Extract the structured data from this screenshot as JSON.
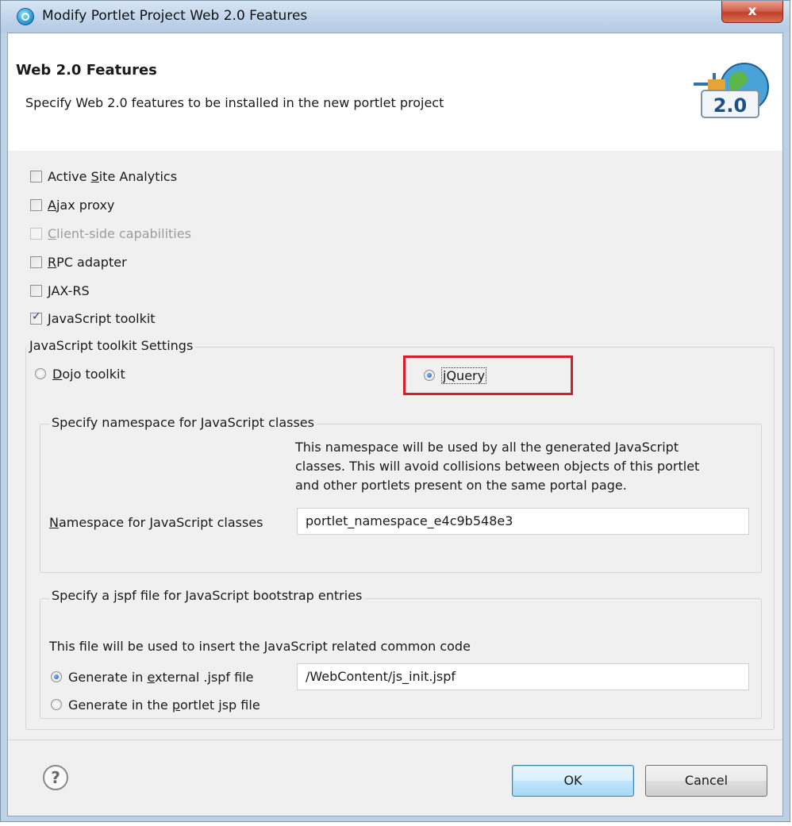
{
  "window": {
    "title": "Modify Portlet Project Web 2.0 Features",
    "close_glyph": "x",
    "accent": "#1b59b5"
  },
  "header": {
    "title": "Web 2.0 Features",
    "description": "Specify Web 2.0 features to be installed in the new portlet project",
    "banner_text": "2.0"
  },
  "features": [
    {
      "pre": "Active ",
      "mnemonic": "S",
      "post": "ite Analytics",
      "checked": false,
      "enabled": true
    },
    {
      "pre": "",
      "mnemonic": "A",
      "post": "jax proxy",
      "checked": false,
      "enabled": true
    },
    {
      "pre": "",
      "mnemonic": "C",
      "post": "lient-side capabilities",
      "checked": false,
      "enabled": false
    },
    {
      "pre": "",
      "mnemonic": "R",
      "post": "PC adapter",
      "checked": false,
      "enabled": true
    },
    {
      "pre": "JAX-RS",
      "mnemonic": "",
      "post": "",
      "checked": false,
      "enabled": true
    },
    {
      "pre": "JavaScript toolkit",
      "mnemonic": "",
      "post": "",
      "checked": true,
      "enabled": true
    }
  ],
  "toolkit": {
    "group_label": "JavaScript toolkit Settings",
    "dojo": {
      "pre": "",
      "mnemonic": "D",
      "post": "ojo toolkit",
      "selected": false
    },
    "jquery": {
      "pre": "",
      "mnemonic": "j",
      "post": "Query",
      "selected": true
    },
    "highlight_color": "#d81e28"
  },
  "namespace": {
    "group_label": "Specify namespace for JavaScript classes",
    "help_lines": [
      "This namespace will be used by all the generated JavaScript",
      "classes. This will avoid collisions between objects of this portlet",
      "and other portlets present on the same portal page."
    ],
    "field_label_mnemonic": "N",
    "field_label_rest": "amespace for JavaScript classes",
    "value": "portlet_namespace_e4c9b548e3"
  },
  "bootstrap": {
    "group_label": "Specify a jspf file for JavaScript bootstrap entries",
    "help": "This file will be used to insert the JavaScript related common code",
    "external": {
      "pre": "Generate in ",
      "mnemonic": "e",
      "post": "xternal .jspf file",
      "selected": true
    },
    "portlet": {
      "pre": "Generate in the ",
      "mnemonic": "p",
      "post": "ortlet jsp file",
      "selected": false
    },
    "path_value": "/WebContent/js_init.jspf"
  },
  "footer": {
    "help_glyph": "?",
    "ok_label": "OK",
    "cancel_label": "Cancel"
  }
}
